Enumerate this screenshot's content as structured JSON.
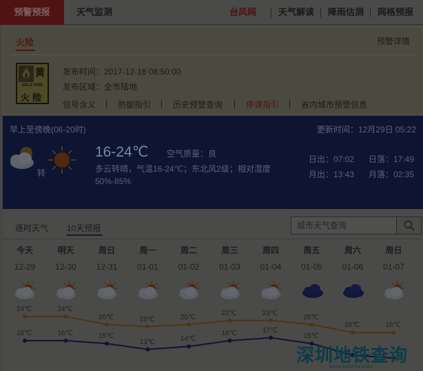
{
  "topnav": {
    "tabs": [
      {
        "label": "预警预报",
        "active": true
      },
      {
        "label": "天气监测"
      },
      {
        "label": "台风网",
        "highlight": true
      },
      {
        "label": "天气解读"
      },
      {
        "label": "降雨估测"
      },
      {
        "label": "网格预报"
      }
    ]
  },
  "warning": {
    "tab_label": "火险",
    "detail_link": "预警详情",
    "badge": {
      "level": "黄",
      "en": "WILD FIRE",
      "cn": "火险"
    },
    "publish_time": "发布时间：2017-12-18 08:50:00",
    "publish_area": "发布区域：全市陆地",
    "links": [
      "信号含义",
      "防御指引",
      "历史预警查询",
      "停课指引",
      "省内城市预警信息"
    ]
  },
  "forecast": {
    "period": "早上至傍晚(06-20时)",
    "update_time": "更新时间：12月29日 05:22",
    "temp_range": "16-24℃",
    "aqi": "空气质量：良",
    "description": "多云转晴，气温16-24℃；东北风2级；相对湿度50%-85%",
    "transition_word": "转",
    "sunrise": "日出：07:02",
    "sunset": "日落：17:49",
    "moonrise": "月出：13:43",
    "moonset": "月落：02:35"
  },
  "tenday": {
    "tabs": [
      "逐时天气",
      "10天预报"
    ],
    "active_tab": 1,
    "search_placeholder": "城市天气查询",
    "days": [
      {
        "name": "今天",
        "date": "12-29",
        "icon": "partly-cloudy-icon"
      },
      {
        "name": "明天",
        "date": "12-30",
        "icon": "partly-cloudy-icon"
      },
      {
        "name": "周日",
        "date": "12-31",
        "icon": "partly-cloudy-icon"
      },
      {
        "name": "周一",
        "date": "01-01",
        "icon": "partly-cloudy-icon"
      },
      {
        "name": "周二",
        "date": "01-02",
        "icon": "partly-cloudy-icon"
      },
      {
        "name": "周三",
        "date": "01-03",
        "icon": "partly-cloudy-icon"
      },
      {
        "name": "周四",
        "date": "01-04",
        "icon": "partly-cloudy-icon"
      },
      {
        "name": "周五",
        "date": "01-05",
        "icon": "cloudy-icon"
      },
      {
        "name": "周六",
        "date": "01-06",
        "icon": "cloudy-icon"
      },
      {
        "name": "周日",
        "date": "01-07",
        "icon": "partly-cloudy-icon"
      }
    ],
    "high_labels": [
      "24℃",
      "24℃",
      "20℃",
      "19℃",
      "20℃",
      "22℃",
      "22℃",
      "20℃",
      "16℃",
      "16℃"
    ],
    "low_labels": [
      "16℃",
      "16℃",
      "15℃",
      "13℃",
      "14℃",
      "16℃",
      "17℃",
      "15℃",
      "",
      ""
    ],
    "high_temps": [
      24,
      24,
      20,
      19,
      20,
      22,
      22,
      20,
      16,
      16
    ],
    "low_temps": [
      16,
      16,
      15,
      13,
      14,
      16,
      17,
      15,
      11,
      10
    ],
    "colors": {
      "high": "#4d3613",
      "low": "#0e1634"
    }
  },
  "watermark": {
    "text": "深圳地铁查询",
    "url": "www.kanxsw.com"
  }
}
